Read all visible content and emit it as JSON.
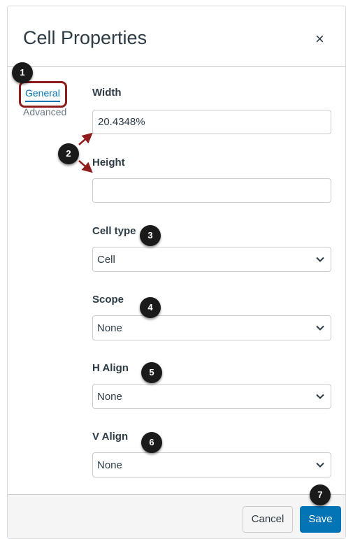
{
  "dialog": {
    "title": "Cell Properties",
    "close_symbol": "×"
  },
  "tabs": [
    {
      "label": "General",
      "active": true
    },
    {
      "label": "Advanced",
      "active": false
    }
  ],
  "form": {
    "width_label": "Width",
    "width_value": "20.4348%",
    "height_label": "Height",
    "height_value": "",
    "cell_type_label": "Cell type",
    "cell_type_value": "Cell",
    "scope_label": "Scope",
    "scope_value": "None",
    "h_align_label": "H Align",
    "h_align_value": "None",
    "v_align_label": "V Align",
    "v_align_value": "None"
  },
  "footer": {
    "cancel_label": "Cancel",
    "save_label": "Save"
  },
  "markers": [
    "1",
    "2",
    "3",
    "4",
    "5",
    "6",
    "7"
  ],
  "colors": {
    "accent": "#0374b5",
    "highlight": "#8e1d1d",
    "marker": "#1a1a1a"
  }
}
